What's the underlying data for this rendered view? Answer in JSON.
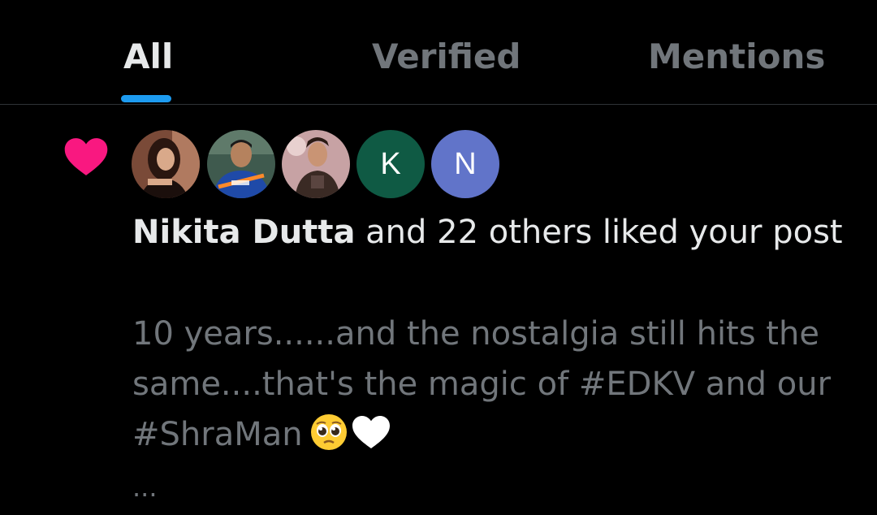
{
  "tabs": [
    {
      "label": "All",
      "active": true
    },
    {
      "label": "Verified",
      "active": false
    },
    {
      "label": "Mentions",
      "active": false
    }
  ],
  "colors": {
    "background": "#000000",
    "accent": "#1d9bf0",
    "like": "#f91880",
    "text_primary": "#e7e9ea",
    "text_secondary": "#71767b",
    "avatar_k": "#0f5a44",
    "avatar_n": "#6174c9"
  },
  "notification": {
    "icon": "heart-icon",
    "avatars": [
      {
        "type": "photo",
        "icon": "user-photo-avatar"
      },
      {
        "type": "photo",
        "icon": "user-photo-avatar"
      },
      {
        "type": "photo",
        "icon": "user-photo-avatar"
      },
      {
        "type": "letter",
        "letter": "K"
      },
      {
        "type": "letter",
        "letter": "N"
      }
    ],
    "actor_name": "Nikita Dutta",
    "summary_rest": " and 22 others liked your post",
    "post_text": "10 years......and the nostalgia still hits the same....that's the magic of #EDKV and our #ShraMan",
    "post_emojis": [
      "pleading-face-emoji",
      "white-heart-emoji"
    ],
    "ellipsis": "..."
  }
}
